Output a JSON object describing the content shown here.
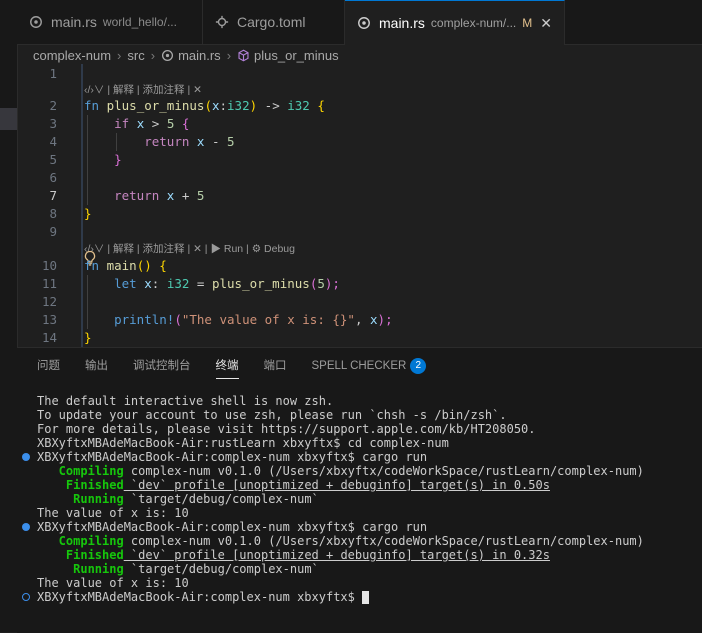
{
  "tabs": [
    {
      "name": "main.rs",
      "desc": "world_hello/...",
      "active": false
    },
    {
      "name": "Cargo.toml",
      "desc": "",
      "active": false
    },
    {
      "name": "main.rs",
      "desc": "complex-num/...",
      "modified": "M",
      "active": true
    }
  ],
  "breadcrumb": [
    "complex-num",
    "src",
    "main.rs",
    "plus_or_minus"
  ],
  "lenses": {
    "top": "‹/›∨ | 解释 | 添加注释 | ✕",
    "main": "‹/›∨ | 解释 | 添加注释 | ✕ | ▶ Run | ⚙ Debug"
  },
  "line_numbers": [
    "1",
    "2",
    "3",
    "4",
    "5",
    "6",
    "7",
    "8",
    "9",
    "10",
    "11",
    "12",
    "13",
    "14"
  ],
  "code": {
    "l2_fn": "fn",
    "l2_name": "plus_or_minus",
    "l2_open": "(",
    "l2_x": "x",
    "l2_colon": ":",
    "l2_ty": "i32",
    "l2_close": ")",
    "l2_arrow": " -> ",
    "l2_ret": "i32",
    "l2_brace": " {",
    "l3_if": "if",
    "l3_x": "x",
    "l3_gt": " > ",
    "l3_num": "5",
    "l3_brace": " {",
    "l4_return": "return",
    "l4_x": "x",
    "l4_minus": " - ",
    "l4_num": "5",
    "l5_brace": "}",
    "l7_return": "return",
    "l7_x": "x",
    "l7_plus": " + ",
    "l7_num": "5",
    "l8_brace": "}",
    "l10_fn": "fn",
    "l10_name": "main",
    "l10_parens": "()",
    "l10_brace": " {",
    "l11_let": "let",
    "l11_x": "x",
    "l11_colon": ": ",
    "l11_ty": "i32",
    "l11_eq": " = ",
    "l11_call": "plus_or_minus",
    "l11_open": "(",
    "l11_num": "5",
    "l11_close": ");",
    "l13_mac": "println!",
    "l13_open": "(",
    "l13_str": "\"The value of x is: {}\"",
    "l13_comma": ", ",
    "l13_x": "x",
    "l13_close": ");",
    "l14_brace": "}"
  },
  "panel": {
    "tabs": [
      "问题",
      "输出",
      "调试控制台",
      "终端",
      "端口",
      "SPELL CHECKER"
    ],
    "badge": "2"
  },
  "terminal": {
    "l1": "The default interactive shell is now zsh.",
    "l2": "To update your account to use zsh, please run `chsh -s /bin/zsh`.",
    "l3": "For more details, please visit https://support.apple.com/kb/HT208050.",
    "l4": "XBXyftxMBAdeMacBook-Air:rustLearn xbxyftx$ cd complex-num",
    "l5": "XBXyftxMBAdeMacBook-Air:complex-num xbxyftx$ cargo run",
    "compiling": "   Compiling",
    "compiling_rest": " complex-num v0.1.0 (/Users/xbxyftx/codeWorkSpace/rustLearn/complex-num)",
    "finished": "    Finished",
    "finished_a": " `dev` profile [unoptimized + debuginfo] target(s) in 0.50s",
    "running": "     Running",
    "running_rest": " `target/debug/complex-num`",
    "value1": "The value of x is: 10",
    "l10": "XBXyftxMBAdeMacBook-Air:complex-num xbxyftx$ cargo run",
    "finished_b": " `dev` profile [unoptimized + debuginfo] target(s) in 0.32s",
    "value2": "The value of x is: 10",
    "prompt": "XBXyftxMBAdeMacBook-Air:complex-num xbxyftx$ "
  }
}
